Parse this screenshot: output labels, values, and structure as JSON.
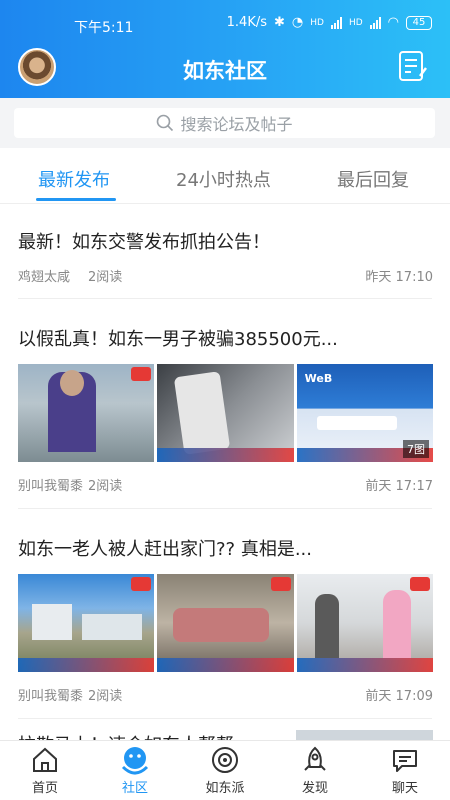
{
  "status": {
    "time": "下午5:11",
    "speed": "1.4K/s",
    "signal1": "HD",
    "signal2": "HD",
    "battery": "45"
  },
  "header": {
    "title": "如东社区"
  },
  "search": {
    "placeholder": "搜索论坛及帖子"
  },
  "tabs": [
    {
      "label": "最新发布",
      "active": true
    },
    {
      "label": "24小时热点",
      "active": false
    },
    {
      "label": "最后回复",
      "active": false
    }
  ],
  "posts": [
    {
      "title": "最新！如东交警发布抓拍公告！",
      "author": "鸡翅太咸",
      "reads": "2阅读",
      "time": "昨天 17:10"
    },
    {
      "title": "以假乱真！如东一男子被骗385500元...",
      "author": "别叫我蜀黍",
      "reads": "2阅读",
      "time": "前天 17:17",
      "images": [
        {
          "scene": "person-photo",
          "label": ""
        },
        {
          "scene": "phone-screen",
          "label": ""
        },
        {
          "scene": "webank-screen",
          "label": "7图"
        }
      ]
    },
    {
      "title": "如东一老人被人赶出家门?? 真相是...",
      "author": "别叫我蜀黍",
      "reads": "2阅读",
      "time": "前天 17:09",
      "images": [
        {
          "scene": "outdoor-building",
          "label": ""
        },
        {
          "scene": "indoor-bed",
          "label": ""
        },
        {
          "scene": "office-people",
          "label": ""
        }
      ]
    },
    {
      "title": "拉散马上！速会如东人帮帮..."
    }
  ],
  "bottom_nav": [
    {
      "label": "首页",
      "icon": "home-icon",
      "active": false
    },
    {
      "label": "社区",
      "icon": "community-icon",
      "active": true
    },
    {
      "label": "如东派",
      "icon": "rudongpai-icon",
      "active": false
    },
    {
      "label": "发现",
      "icon": "rocket-icon",
      "active": false
    },
    {
      "label": "聊天",
      "icon": "chat-icon",
      "active": false
    }
  ],
  "colors": {
    "accent": "#2196f3",
    "header_start": "#1d86ef",
    "header_end": "#2cc0f7"
  }
}
